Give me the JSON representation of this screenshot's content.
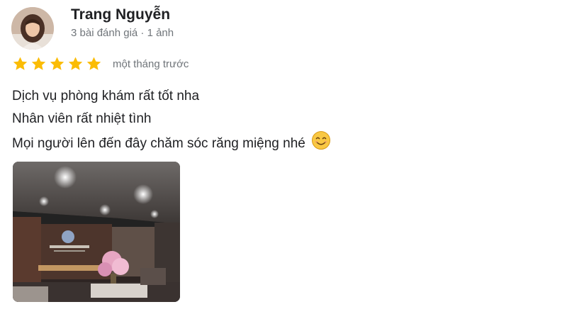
{
  "review": {
    "author": {
      "name": "Trang Nguyễn",
      "meta": "3 bài đánh giá · 1 ảnh",
      "avatar_icon": "user-avatar-photo"
    },
    "rating": {
      "stars": 5,
      "max_stars": 5,
      "star_color": "#fbbc04"
    },
    "time": "một tháng trước",
    "text_lines": [
      "Dịch vụ phòng khám rất tốt nha",
      "Nhân viên rất nhiệt tình",
      "Mọi người lên đến đây chăm sóc răng miệng nhé"
    ],
    "emoji_icon": "smiling-face-icon",
    "photo": {
      "icon": "clinic-interior-photo",
      "count": 1
    }
  }
}
